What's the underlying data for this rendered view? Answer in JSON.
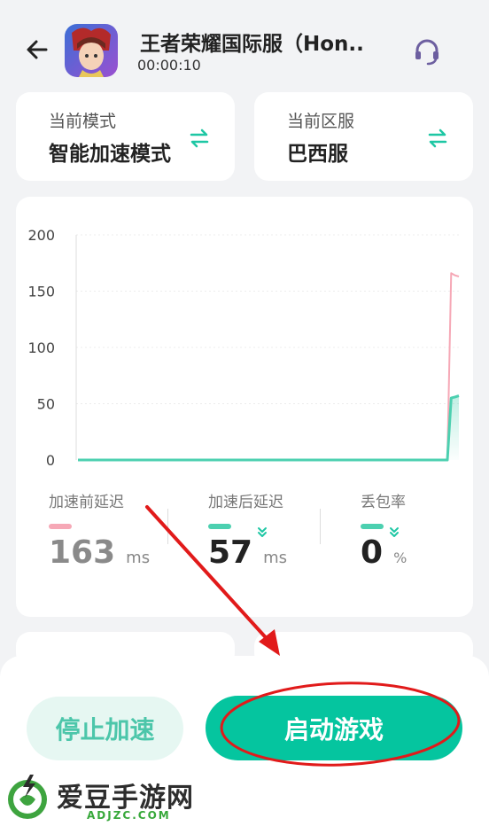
{
  "header": {
    "game_title": "王者荣耀国际服（Hon..",
    "timer": "00:00:10"
  },
  "mode_card": {
    "label": "当前模式",
    "value": "智能加速模式"
  },
  "region_card": {
    "label": "当前区服",
    "value": "巴西服"
  },
  "chart_data": {
    "type": "area",
    "y_ticks": [
      "200",
      "150",
      "100",
      "50",
      "0"
    ],
    "ylim": [
      0,
      200
    ],
    "series": [
      {
        "color": "#f6a8b6",
        "values": [
          0,
          0,
          0,
          0,
          0,
          0,
          0,
          0,
          0,
          0,
          0,
          0,
          0,
          0,
          0,
          0,
          0,
          0,
          0,
          0,
          0,
          0,
          0,
          0,
          0,
          0,
          0,
          0,
          0,
          0,
          0,
          0,
          0,
          0,
          0,
          0,
          0,
          0,
          0,
          0,
          0,
          0,
          0,
          0,
          0,
          0,
          0,
          0,
          0,
          0,
          0,
          0,
          0,
          0,
          0,
          0,
          0,
          0,
          0,
          0,
          0,
          0,
          0,
          0,
          0,
          0,
          0,
          0,
          0,
          0,
          0,
          0,
          0,
          0,
          0,
          0,
          0,
          0,
          0,
          0,
          0,
          0,
          0,
          0,
          0,
          0,
          0,
          0,
          0,
          0,
          0,
          0,
          0,
          0,
          0,
          0,
          0,
          166,
          164,
          163
        ]
      },
      {
        "color": "#4cd0b0",
        "values": [
          0,
          0,
          0,
          0,
          0,
          0,
          0,
          0,
          0,
          0,
          0,
          0,
          0,
          0,
          0,
          0,
          0,
          0,
          0,
          0,
          0,
          0,
          0,
          0,
          0,
          0,
          0,
          0,
          0,
          0,
          0,
          0,
          0,
          0,
          0,
          0,
          0,
          0,
          0,
          0,
          0,
          0,
          0,
          0,
          0,
          0,
          0,
          0,
          0,
          0,
          0,
          0,
          0,
          0,
          0,
          0,
          0,
          0,
          0,
          0,
          0,
          0,
          0,
          0,
          0,
          0,
          0,
          0,
          0,
          0,
          0,
          0,
          0,
          0,
          0,
          0,
          0,
          0,
          0,
          0,
          0,
          0,
          0,
          0,
          0,
          0,
          0,
          0,
          0,
          0,
          0,
          0,
          0,
          0,
          0,
          0,
          0,
          55,
          56,
          57
        ]
      }
    ]
  },
  "stats": {
    "before": {
      "label": "加速前延迟",
      "value": "163",
      "unit": "ms",
      "color": "#f6a8b6"
    },
    "after": {
      "label": "加速后延迟",
      "value": "57",
      "unit": "ms",
      "color": "#4cd0b0"
    },
    "loss": {
      "label": "丢包率",
      "value": "0",
      "unit": "%",
      "color": "#4cd0b0"
    }
  },
  "buttons": {
    "stop": "停止加速",
    "start": "启动游戏"
  },
  "watermark": {
    "title": "爱豆手游网",
    "sub": "ADJZC.COM"
  }
}
